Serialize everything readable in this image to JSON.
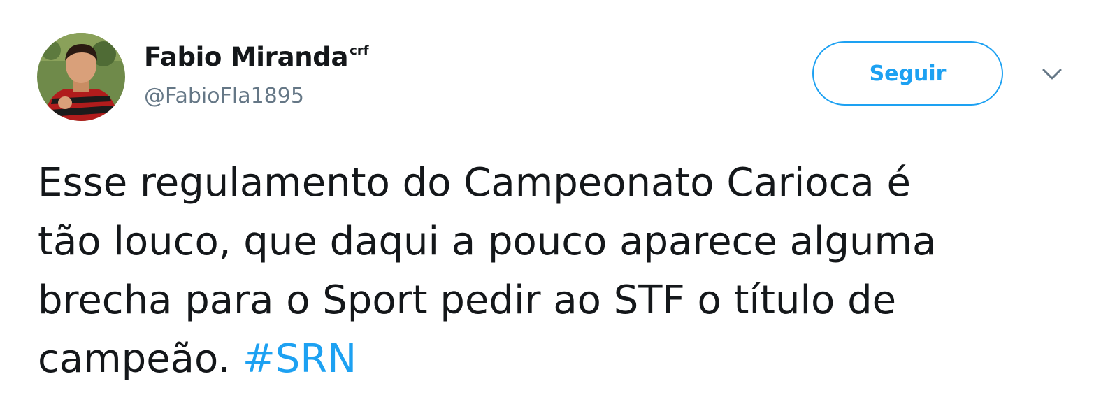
{
  "author": {
    "display_name": "Fabio Miranda",
    "name_superscript": "crf",
    "handle": "@FabioFla1895"
  },
  "actions": {
    "follow_label": "Seguir",
    "more_icon": "chevron-down-icon"
  },
  "tweet": {
    "lines": [
      "Esse regulamento do Campeonato Carioca é",
      "tão louco, que daqui a pouco aparece alguma",
      "brecha para o Sport pedir ao STF o título de",
      "campeão. "
    ],
    "hashtag": "#SRN"
  },
  "colors": {
    "accent": "#1da1f2",
    "text": "#14171a",
    "secondary_text": "#657786"
  }
}
